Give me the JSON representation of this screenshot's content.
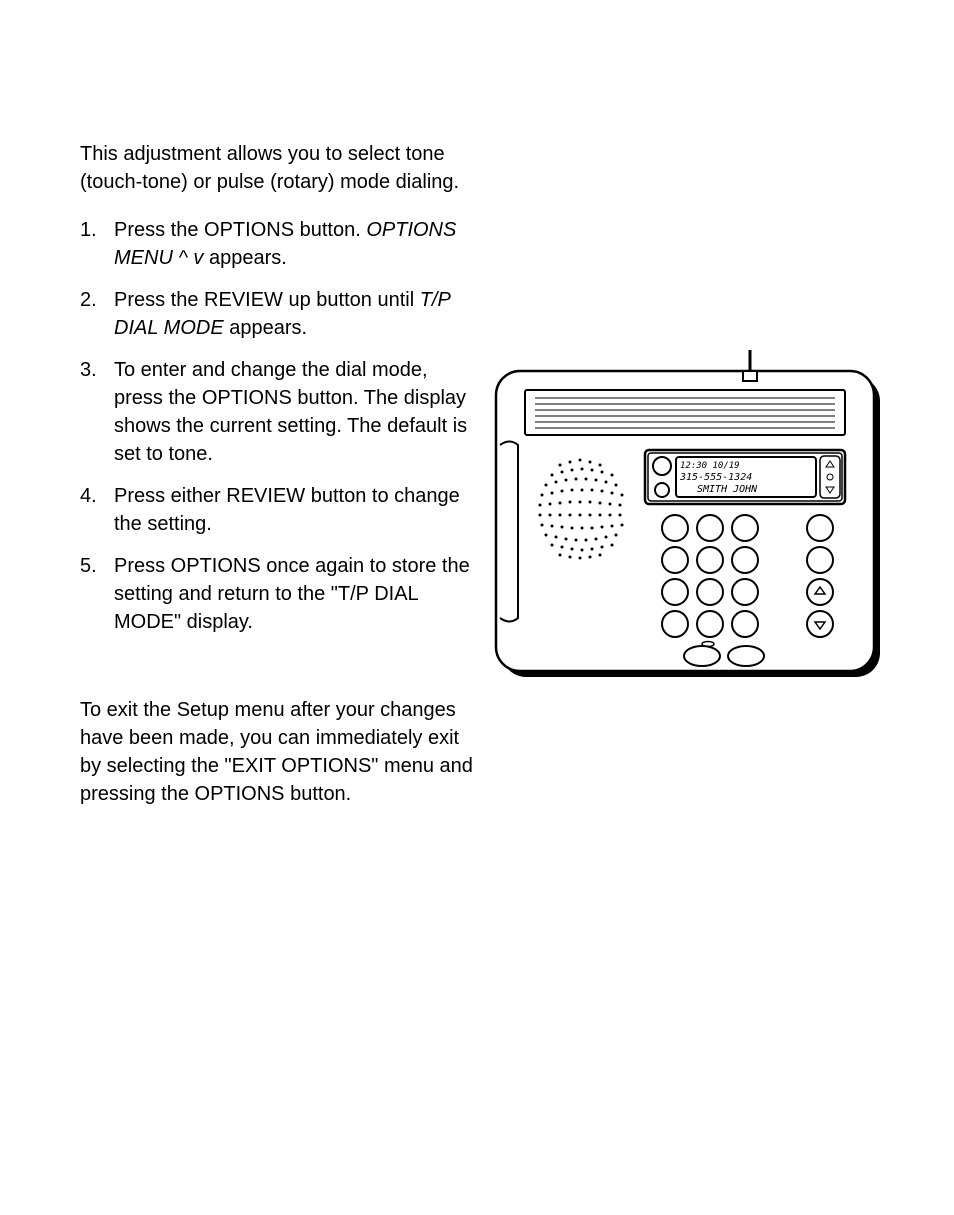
{
  "intro": "This adjustment allows you to select tone (touch-tone) or pulse (rotary) mode dialing.",
  "steps": [
    {
      "pre": "Press the OPTIONS button. ",
      "em": "OPTIONS MENU ^ v",
      "post": " appears."
    },
    {
      "pre": "Press the REVIEW up button until ",
      "em": "T/P DIAL MODE",
      "post": " appears."
    },
    {
      "pre": "To enter and change the dial mode, press the OPTIONS button. The display shows the current setting. The default is set to tone.",
      "em": "",
      "post": ""
    },
    {
      "pre": "Press either REVIEW button to change the setting.",
      "em": "",
      "post": ""
    },
    {
      "pre": "Press OPTIONS once again to store the setting and return to the \"T/P DIAL MODE\" display.",
      "em": "",
      "post": ""
    }
  ],
  "outro": "To exit the Setup menu after your changes have been made, you can immediately exit by selecting the \"EXIT OPTIONS\" menu and pressing the OPTIONS button.",
  "illustration": {
    "lcd_line1": "12:30  10/19",
    "lcd_line2": "315-555-1324",
    "lcd_line3": "SMITH JOHN"
  }
}
